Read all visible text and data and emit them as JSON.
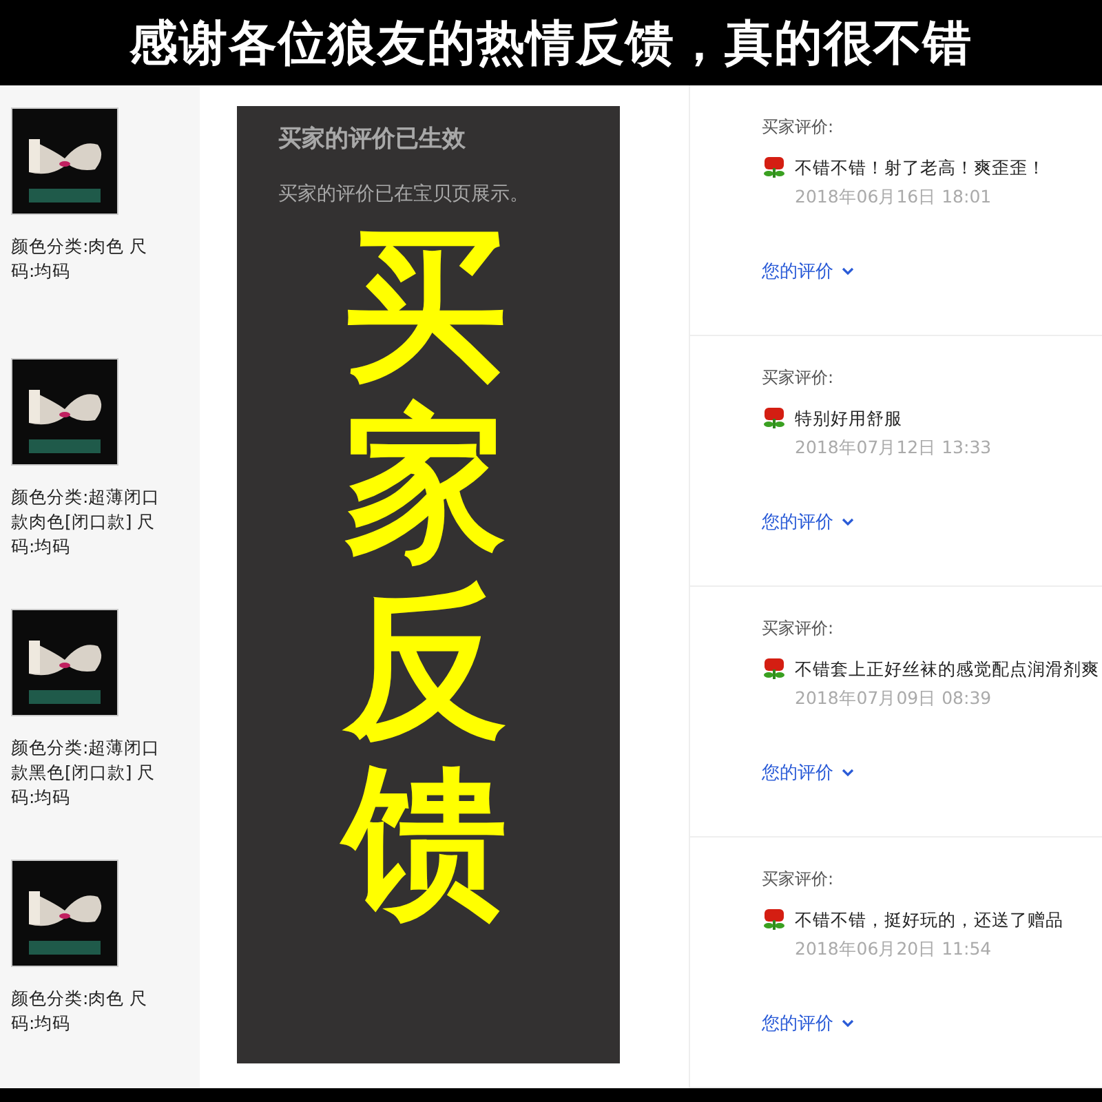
{
  "header": {
    "title": "感谢各位狼友的热情反馈，真的很不错"
  },
  "overlay": {
    "title": "买家反馈"
  },
  "reviews": [
    {
      "sku": "颜色分类:肉色  尺码:均码",
      "status_title": "买家的评价已生效",
      "status_text": "买家的评价已在宝贝页展示。",
      "label": "买家评价:",
      "comment": "不错不错！射了老高！爽歪歪！",
      "date": "2018年06月16日 18:01",
      "link": "您的评价"
    },
    {
      "sku": "颜色分类:超薄闭口款肉色[闭口款]  尺码:均码",
      "label": "买家评价:",
      "comment": "特别好用舒服",
      "date": "2018年07月12日 13:33",
      "link": "您的评价"
    },
    {
      "sku": "颜色分类:超薄闭口款黑色[闭口款]  尺码:均码",
      "label": "买家评价:",
      "comment": "不错套上正好丝袜的感觉配点润滑剂爽",
      "date": "2018年07月09日 08:39",
      "link": "您的评价"
    },
    {
      "sku": "颜色分类:肉色  尺码:均码",
      "label": "买家评价:",
      "comment": "不错不错，挺好玩的，还送了赠品",
      "date": "2018年06月20日 11:54",
      "link": "您的评价"
    }
  ]
}
